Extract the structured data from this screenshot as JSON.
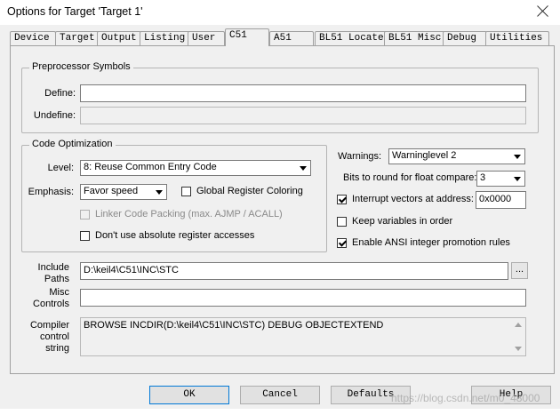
{
  "window": {
    "title": "Options for Target 'Target 1'"
  },
  "tabs": [
    {
      "label": "Device"
    },
    {
      "label": "Target"
    },
    {
      "label": "Output"
    },
    {
      "label": "Listing"
    },
    {
      "label": "User"
    },
    {
      "label": "C51"
    },
    {
      "label": "A51"
    },
    {
      "label": "BL51 Locate"
    },
    {
      "label": "BL51 Misc"
    },
    {
      "label": "Debug"
    },
    {
      "label": "Utilities"
    }
  ],
  "preprocessor": {
    "legend": "Preprocessor Symbols",
    "define_label": "Define:",
    "define_value": "",
    "undefine_label": "Undefine:",
    "undefine_value": ""
  },
  "optimization": {
    "legend": "Code Optimization",
    "level_label": "Level:",
    "level_value": "8: Reuse Common Entry Code",
    "emphasis_label": "Emphasis:",
    "emphasis_value": "Favor speed",
    "global_register_label": "Global Register Coloring",
    "linker_packing_label": "Linker Code Packing (max. AJMP / ACALL)",
    "no_absolute_label": "Don't use absolute register accesses"
  },
  "right": {
    "warnings_label": "Warnings:",
    "warnings_value": "Warninglevel 2",
    "bits_label": "Bits to round for float compare:",
    "bits_value": "3",
    "interrupt_label": "Interrupt vectors at address:",
    "interrupt_value": "0x0000",
    "keep_vars_label": "Keep variables in order",
    "ansi_label": "Enable ANSI integer promotion rules"
  },
  "paths": {
    "include_label_1": "Include",
    "include_label_2": "Paths",
    "include_value": "D:\\keil4\\C51\\INC\\STC",
    "browse_label": "...",
    "misc_label_1": "Misc",
    "misc_label_2": "Controls",
    "misc_value": "",
    "compiler_label_1": "Compiler",
    "compiler_label_2": "control",
    "compiler_label_3": "string",
    "compiler_value": "BROWSE INCDIR(D:\\keil4\\C51\\INC\\STC) DEBUG OBJECTEXTEND"
  },
  "buttons": {
    "ok": "OK",
    "cancel": "Cancel",
    "defaults": "Defaults",
    "help": "Help"
  },
  "watermark": "https://blog.csdn.net/m0_48000"
}
